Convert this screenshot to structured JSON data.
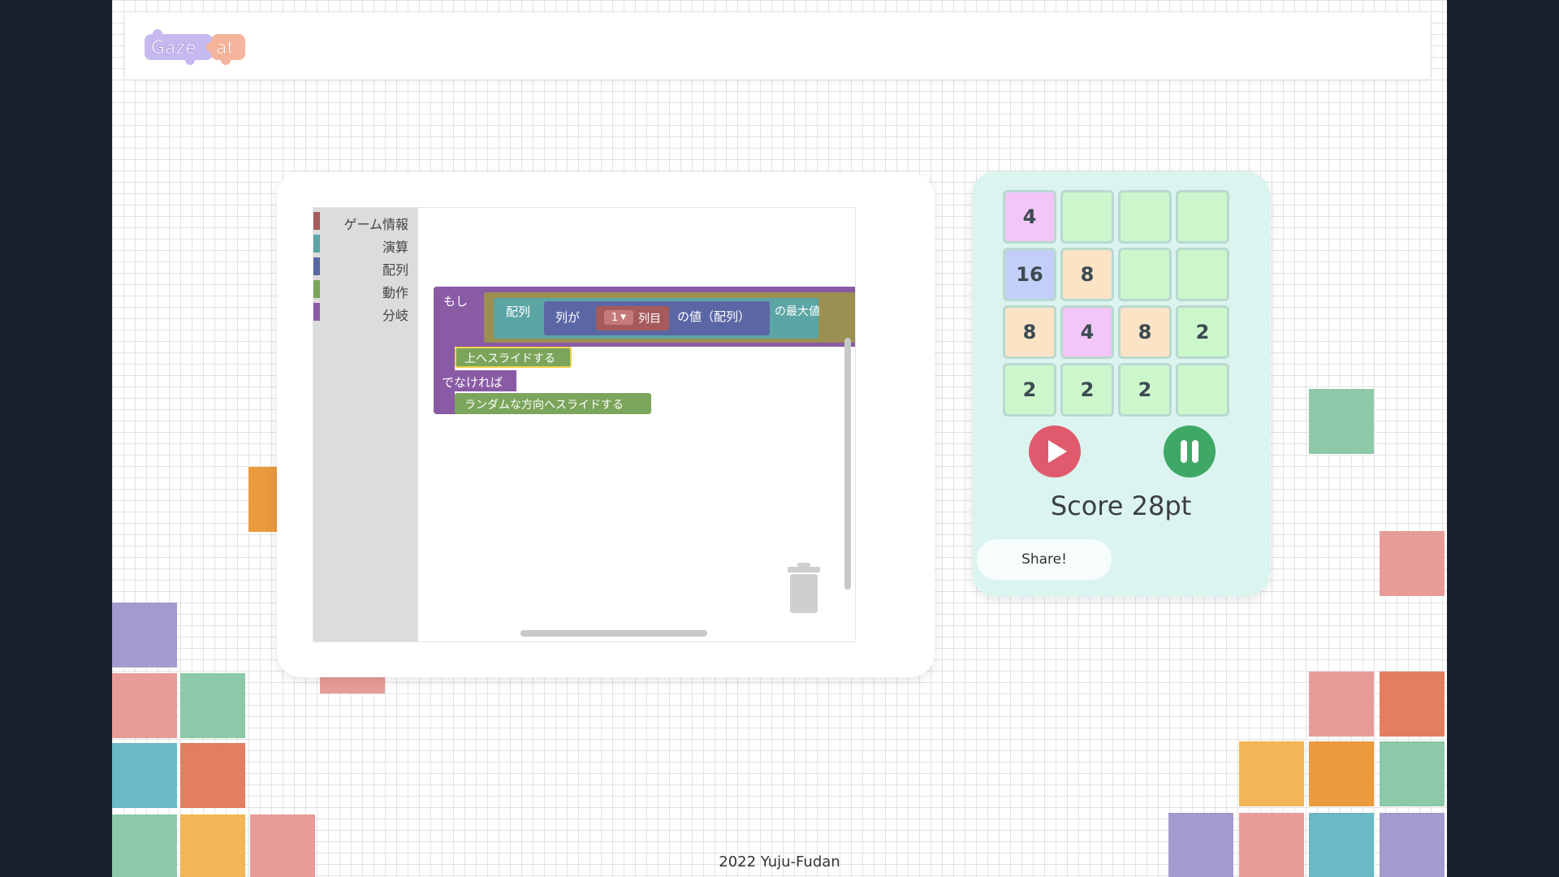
{
  "app": {
    "logo_text": "Gaze-at"
  },
  "toolbox": {
    "categories": [
      {
        "label": "ゲーム情報",
        "color": "#a55b5b"
      },
      {
        "label": "演算",
        "color": "#5ba5a5"
      },
      {
        "label": "配列",
        "color": "#5b67a5"
      },
      {
        "label": "動作",
        "color": "#7ba55b"
      },
      {
        "label": "分岐",
        "color": "#8a5ba5"
      }
    ]
  },
  "blocks": {
    "if_label": "もし",
    "array_label": "配列",
    "column_label": "列が",
    "dropdown_value": "1",
    "column_suffix": "列目",
    "array_value": "の値（配列）",
    "max_label": "の最大値",
    "slide_up": "上へスライドする",
    "else_label": "でなければ",
    "slide_random": "ランダムな方向へスライドする"
  },
  "game": {
    "board": [
      [
        "4",
        "",
        "",
        ""
      ],
      [
        "16",
        "8",
        "",
        ""
      ],
      [
        "8",
        "4",
        "8",
        "2"
      ],
      [
        "2",
        "2",
        "2",
        ""
      ]
    ],
    "tile_colors": {
      "": "#ccf7cc",
      "2": "#ccf7cc",
      "4": "#f2c6f7",
      "8": "#fbe3c6",
      "16": "#c3cff8"
    },
    "score_text": "Score 28pt",
    "share_label": "Share!"
  },
  "colors": {
    "play": "#e05a6e",
    "pause": "#3fa866",
    "page_background": "#1a202c"
  },
  "footer": {
    "text": "2022 Yuju-Fudan"
  }
}
